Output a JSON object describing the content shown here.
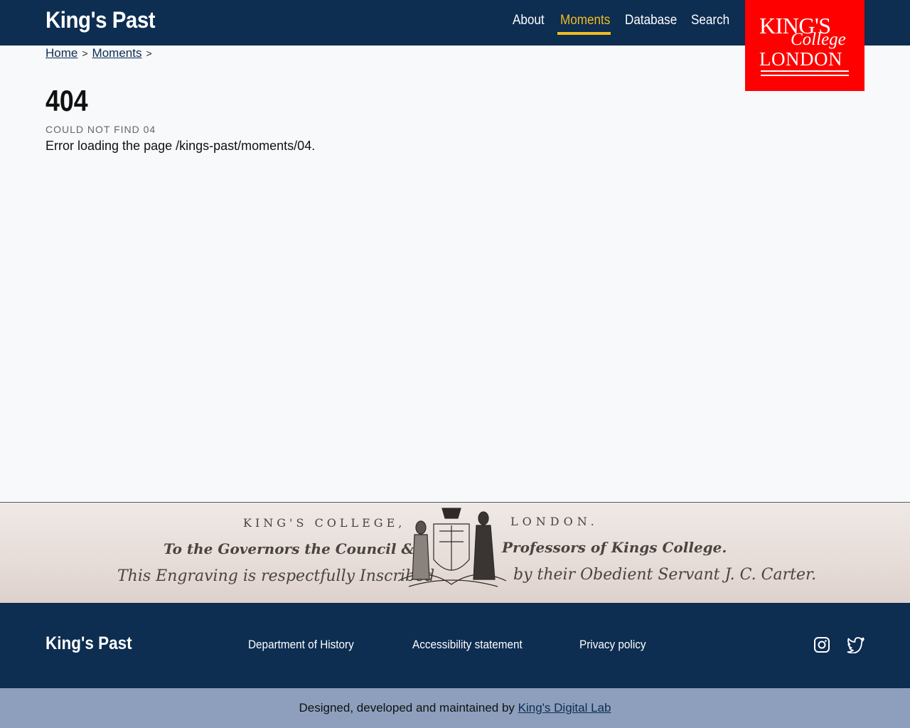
{
  "header": {
    "site_title": "King's Past",
    "nav": [
      "About",
      "Moments",
      "Database",
      "Search"
    ],
    "active_nav": "Moments",
    "logo": {
      "line1": "KING'S",
      "line2": "College",
      "line3": "LONDON",
      "color": "#fe0000"
    }
  },
  "breadcrumb": {
    "home": "Home",
    "section": "Moments",
    "separator": ">"
  },
  "error": {
    "code": "404",
    "subtitle": "COULD NOT FIND 04",
    "message": "Error loading the page /kings-past/moments/04."
  },
  "banner": {
    "line1a": "KING'S COLLEGE,",
    "line1b": "LONDON.",
    "line2a": "To the Governors the Council &",
    "line2b": "Professors of Kings College.",
    "line3a": "This Engraving is respectfully Inscribed",
    "line3b": "by their Obedient Servant J. C. Carter."
  },
  "footer": {
    "title": "King's Past",
    "links": [
      "Department of History",
      "Accessibility statement",
      "Privacy policy"
    ],
    "social": [
      "instagram-icon",
      "twitter-icon"
    ]
  },
  "credits": {
    "text": "Designed, developed and maintained by",
    "link": "King's Digital Lab"
  },
  "colors": {
    "navy": "#0d2d51",
    "accent": "#f2bd1d",
    "credits_bg": "#8d9fbc",
    "page_bg": "#f7f9fb"
  }
}
